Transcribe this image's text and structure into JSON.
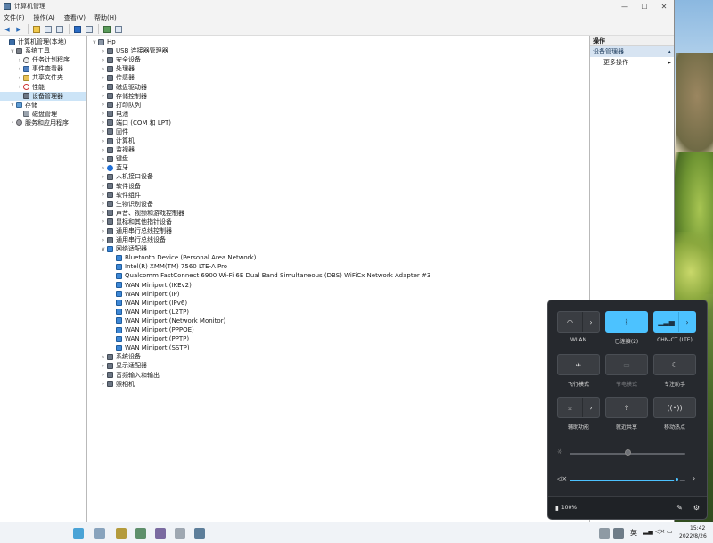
{
  "window": {
    "title": "计算机管理",
    "controls": [
      "—",
      "☐",
      "✕"
    ]
  },
  "menu": [
    "文件(F)",
    "操作(A)",
    "查看(V)",
    "帮助(H)"
  ],
  "left_tree": [
    {
      "label": "计算机管理(本地)",
      "level": 0,
      "exp": "",
      "icon": "pc"
    },
    {
      "label": "系统工具",
      "level": 1,
      "exp": "∨",
      "icon": "tool"
    },
    {
      "label": "任务计划程序",
      "level": 2,
      "exp": "›",
      "icon": "clock"
    },
    {
      "label": "事件查看器",
      "level": 2,
      "exp": "›",
      "icon": "event"
    },
    {
      "label": "共享文件夹",
      "level": 2,
      "exp": "›",
      "icon": "folder"
    },
    {
      "label": "性能",
      "level": 2,
      "exp": "›",
      "icon": "perf"
    },
    {
      "label": "设备管理器",
      "level": 2,
      "exp": "",
      "icon": "dev",
      "selected": true
    },
    {
      "label": "存储",
      "level": 1,
      "exp": "∨",
      "icon": "store"
    },
    {
      "label": "磁盘管理",
      "level": 2,
      "exp": "",
      "icon": "disk"
    },
    {
      "label": "服务和应用程序",
      "level": 1,
      "exp": "›",
      "icon": "svc"
    }
  ],
  "device_tree": {
    "root": "Hp",
    "categories_top": [
      "USB 连接器管理器",
      "安全设备",
      "处理器",
      "传感器",
      "磁盘驱动器",
      "存储控制器",
      "打印队列",
      "电池",
      "端口 (COM 和 LPT)",
      "固件",
      "计算机",
      "监视器",
      "键盘",
      "蓝牙",
      "人机接口设备",
      "软件设备",
      "软件组件",
      "生物识别设备",
      "声音、视频和游戏控制器",
      "鼠标和其他指针设备",
      "通用串行总线控制器",
      "通用串行总线设备"
    ],
    "expanded_category": "网络适配器",
    "network_adapters": [
      "Bluetooth Device (Personal Area Network)",
      "Intel(R) XMM(TM) 7560 LTE-A Pro",
      "Qualcomm FastConnect 6900 Wi-Fi 6E Dual Band Simultaneous (DBS) WiFiCx Network Adapter #3",
      "WAN Miniport (IKEv2)",
      "WAN Miniport (IP)",
      "WAN Miniport (IPv6)",
      "WAN Miniport (L2TP)",
      "WAN Miniport (Network Monitor)",
      "WAN Miniport (PPPOE)",
      "WAN Miniport (PPTP)",
      "WAN Miniport (SSTP)"
    ],
    "categories_bottom": [
      "系统设备",
      "显示适配器",
      "音频输入和输出",
      "照相机"
    ]
  },
  "actions": {
    "header": "操作",
    "section": "设备管理器",
    "more": "更多操作"
  },
  "quick_settings": {
    "tiles": [
      {
        "label": "WLAN",
        "icon": "wifi-icon",
        "on": false,
        "split": true
      },
      {
        "label": "已连接(2)",
        "icon": "bluetooth-icon",
        "on": true,
        "split": false
      },
      {
        "label": "CHN-CT (LTE)",
        "icon": "cellular-icon",
        "on": true,
        "split": true
      },
      {
        "label": "飞行模式",
        "icon": "airplane-icon",
        "on": false,
        "split": false
      },
      {
        "label": "节电模式",
        "icon": "battery-saver-icon",
        "on": false,
        "split": false,
        "disabled": true
      },
      {
        "label": "专注助手",
        "icon": "moon-icon",
        "on": false,
        "split": false
      },
      {
        "label": "辅助功能",
        "icon": "accessibility-icon",
        "on": false,
        "split": true
      },
      {
        "label": "就近共享",
        "icon": "share-icon",
        "on": false,
        "split": false
      },
      {
        "label": "移动热点",
        "icon": "hotspot-icon",
        "on": false,
        "split": false
      }
    ],
    "brightness": 0.5,
    "volume": 0.93,
    "battery": "100%"
  },
  "taskbar": {
    "time": "15:42",
    "date": "2022/8/26",
    "ime": "英"
  },
  "colors": {
    "accent": "#4cc2ff",
    "panel": "#26292e",
    "selection": "#cce4f7"
  }
}
